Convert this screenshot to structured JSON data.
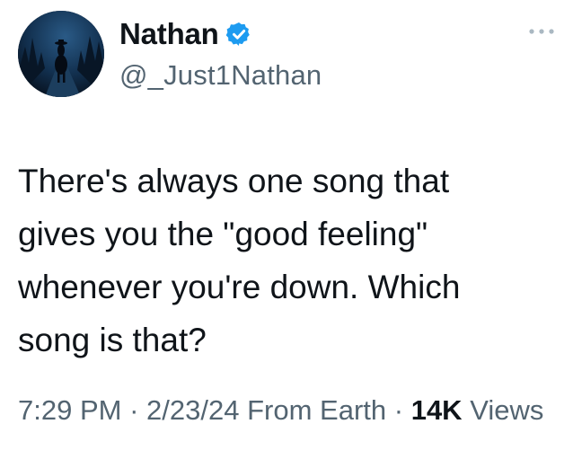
{
  "author": {
    "display_name": "Nathan",
    "handle": "@_Just1Nathan",
    "verified_icon": "verified-badge-icon",
    "avatar": "night-rider-avatar"
  },
  "menu_icon": "more-options-icon",
  "tweet": {
    "text": "There's always one song that\ngives you the \"good feeling\"\nwhenever you're down. Which\nsong is that?"
  },
  "meta": {
    "time": "7:29 PM",
    "separator": "·",
    "date": "2/23/24",
    "source": "From Earth",
    "views_count": "14K",
    "views_label": "Views"
  },
  "colors": {
    "text": "#0f1419",
    "secondary": "#536471",
    "verified": "#1d9bf0",
    "menu_dots": "#aab8c2"
  }
}
